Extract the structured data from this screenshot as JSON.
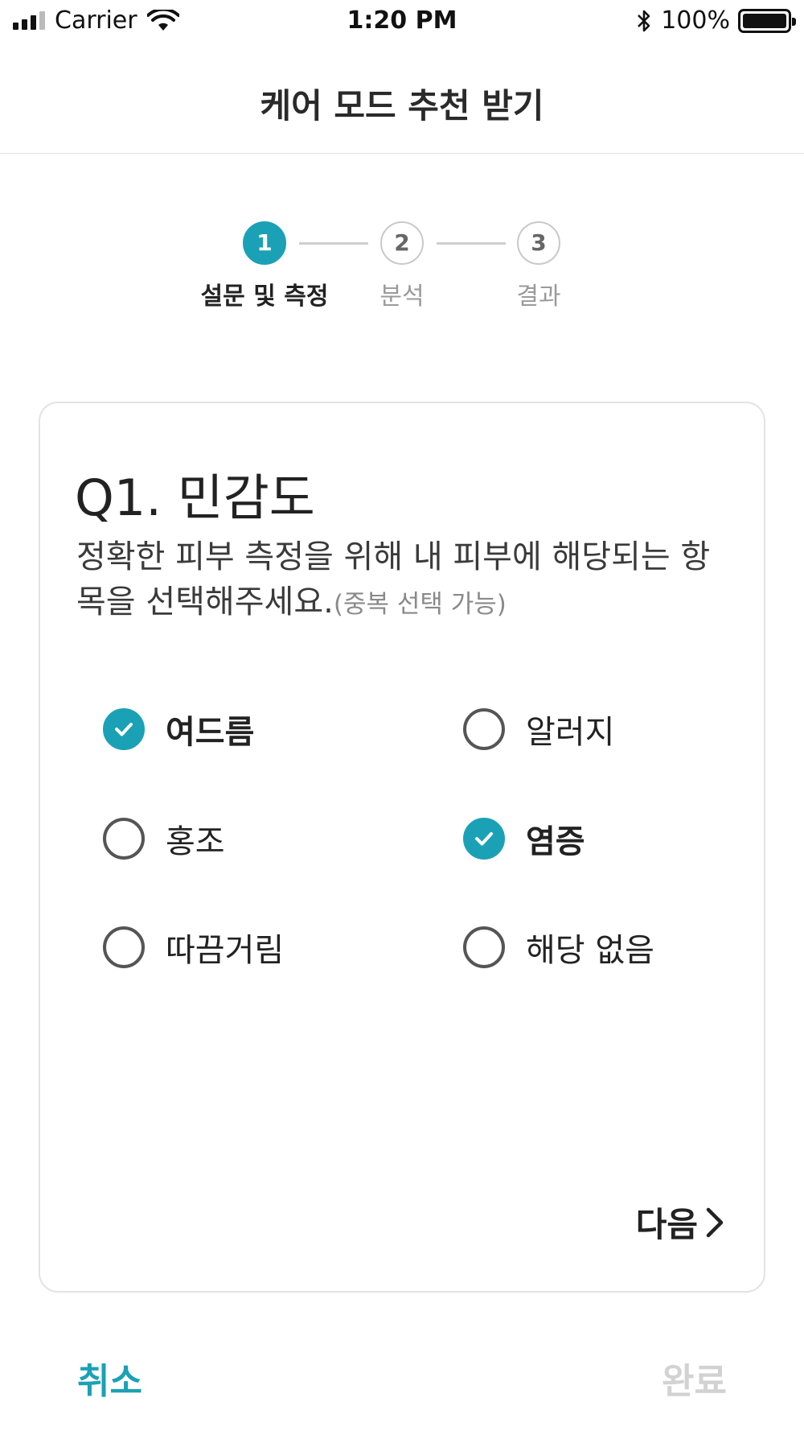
{
  "status_bar": {
    "carrier": "Carrier",
    "time": "1:20 PM",
    "battery": "100%"
  },
  "nav": {
    "title": "케어 모드 추천 받기"
  },
  "steps": [
    {
      "number": "1",
      "label": "설문 및 측정",
      "active": true
    },
    {
      "number": "2",
      "label": "분석",
      "active": false
    },
    {
      "number": "3",
      "label": "결과",
      "active": false
    }
  ],
  "question": {
    "title": "Q1. 민감도",
    "description": "정확한 피부 측정을 위해 내 피부에 해당되는 항목을 선택해주세요.",
    "note": "(중복 선택 가능)"
  },
  "options": [
    {
      "label": "여드름",
      "checked": true
    },
    {
      "label": "알러지",
      "checked": false
    },
    {
      "label": "홍조",
      "checked": false
    },
    {
      "label": "염증",
      "checked": true
    },
    {
      "label": "따끔거림",
      "checked": false
    },
    {
      "label": "해당 없음",
      "checked": false
    }
  ],
  "buttons": {
    "next": "다음",
    "cancel": "취소",
    "done": "완료"
  },
  "colors": {
    "accent": "#1ba1b5",
    "disabled": "#d2d2d2"
  }
}
